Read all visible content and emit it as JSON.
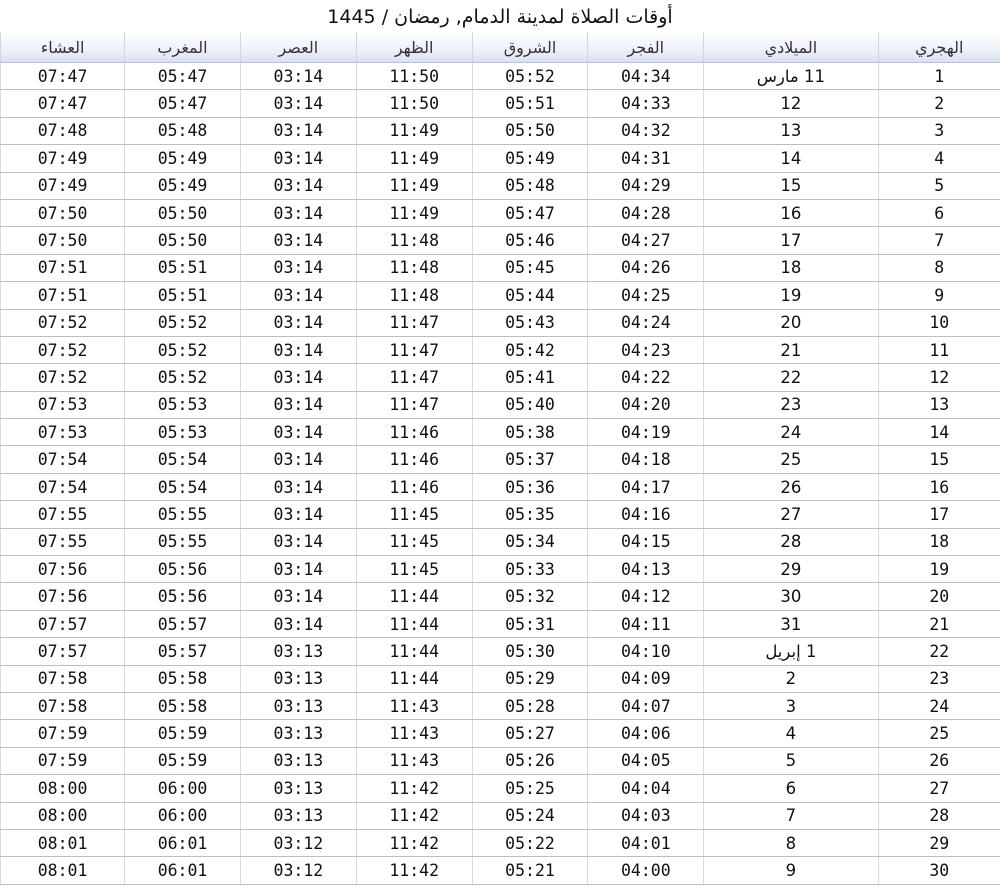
{
  "title": "أوقات الصلاة لمدينة الدمام, رمضان / 1445",
  "headers": [
    "الهجري",
    "الميلادي",
    "الفجر",
    "الشروق",
    "الظهر",
    "العصر",
    "المغرب",
    "العشاء"
  ],
  "rows": [
    [
      "1",
      "11 مارس",
      "04:34",
      "05:52",
      "11:50",
      "03:14",
      "05:47",
      "07:47"
    ],
    [
      "2",
      "12",
      "04:33",
      "05:51",
      "11:50",
      "03:14",
      "05:47",
      "07:47"
    ],
    [
      "3",
      "13",
      "04:32",
      "05:50",
      "11:49",
      "03:14",
      "05:48",
      "07:48"
    ],
    [
      "4",
      "14",
      "04:31",
      "05:49",
      "11:49",
      "03:14",
      "05:49",
      "07:49"
    ],
    [
      "5",
      "15",
      "04:29",
      "05:48",
      "11:49",
      "03:14",
      "05:49",
      "07:49"
    ],
    [
      "6",
      "16",
      "04:28",
      "05:47",
      "11:49",
      "03:14",
      "05:50",
      "07:50"
    ],
    [
      "7",
      "17",
      "04:27",
      "05:46",
      "11:48",
      "03:14",
      "05:50",
      "07:50"
    ],
    [
      "8",
      "18",
      "04:26",
      "05:45",
      "11:48",
      "03:14",
      "05:51",
      "07:51"
    ],
    [
      "9",
      "19",
      "04:25",
      "05:44",
      "11:48",
      "03:14",
      "05:51",
      "07:51"
    ],
    [
      "10",
      "20",
      "04:24",
      "05:43",
      "11:47",
      "03:14",
      "05:52",
      "07:52"
    ],
    [
      "11",
      "21",
      "04:23",
      "05:42",
      "11:47",
      "03:14",
      "05:52",
      "07:52"
    ],
    [
      "12",
      "22",
      "04:22",
      "05:41",
      "11:47",
      "03:14",
      "05:52",
      "07:52"
    ],
    [
      "13",
      "23",
      "04:20",
      "05:40",
      "11:47",
      "03:14",
      "05:53",
      "07:53"
    ],
    [
      "14",
      "24",
      "04:19",
      "05:38",
      "11:46",
      "03:14",
      "05:53",
      "07:53"
    ],
    [
      "15",
      "25",
      "04:18",
      "05:37",
      "11:46",
      "03:14",
      "05:54",
      "07:54"
    ],
    [
      "16",
      "26",
      "04:17",
      "05:36",
      "11:46",
      "03:14",
      "05:54",
      "07:54"
    ],
    [
      "17",
      "27",
      "04:16",
      "05:35",
      "11:45",
      "03:14",
      "05:55",
      "07:55"
    ],
    [
      "18",
      "28",
      "04:15",
      "05:34",
      "11:45",
      "03:14",
      "05:55",
      "07:55"
    ],
    [
      "19",
      "29",
      "04:13",
      "05:33",
      "11:45",
      "03:14",
      "05:56",
      "07:56"
    ],
    [
      "20",
      "30",
      "04:12",
      "05:32",
      "11:44",
      "03:14",
      "05:56",
      "07:56"
    ],
    [
      "21",
      "31",
      "04:11",
      "05:31",
      "11:44",
      "03:14",
      "05:57",
      "07:57"
    ],
    [
      "22",
      "1 إبريل",
      "04:10",
      "05:30",
      "11:44",
      "03:13",
      "05:57",
      "07:57"
    ],
    [
      "23",
      "2",
      "04:09",
      "05:29",
      "11:44",
      "03:13",
      "05:58",
      "07:58"
    ],
    [
      "24",
      "3",
      "04:07",
      "05:28",
      "11:43",
      "03:13",
      "05:58",
      "07:58"
    ],
    [
      "25",
      "4",
      "04:06",
      "05:27",
      "11:43",
      "03:13",
      "05:59",
      "07:59"
    ],
    [
      "26",
      "5",
      "04:05",
      "05:26",
      "11:43",
      "03:13",
      "05:59",
      "07:59"
    ],
    [
      "27",
      "6",
      "04:04",
      "05:25",
      "11:42",
      "03:13",
      "06:00",
      "08:00"
    ],
    [
      "28",
      "7",
      "04:03",
      "05:24",
      "11:42",
      "03:13",
      "06:00",
      "08:00"
    ],
    [
      "29",
      "8",
      "04:01",
      "05:22",
      "11:42",
      "03:12",
      "06:01",
      "08:01"
    ],
    [
      "30",
      "9",
      "04:00",
      "05:21",
      "11:42",
      "03:12",
      "06:01",
      "08:01"
    ]
  ]
}
